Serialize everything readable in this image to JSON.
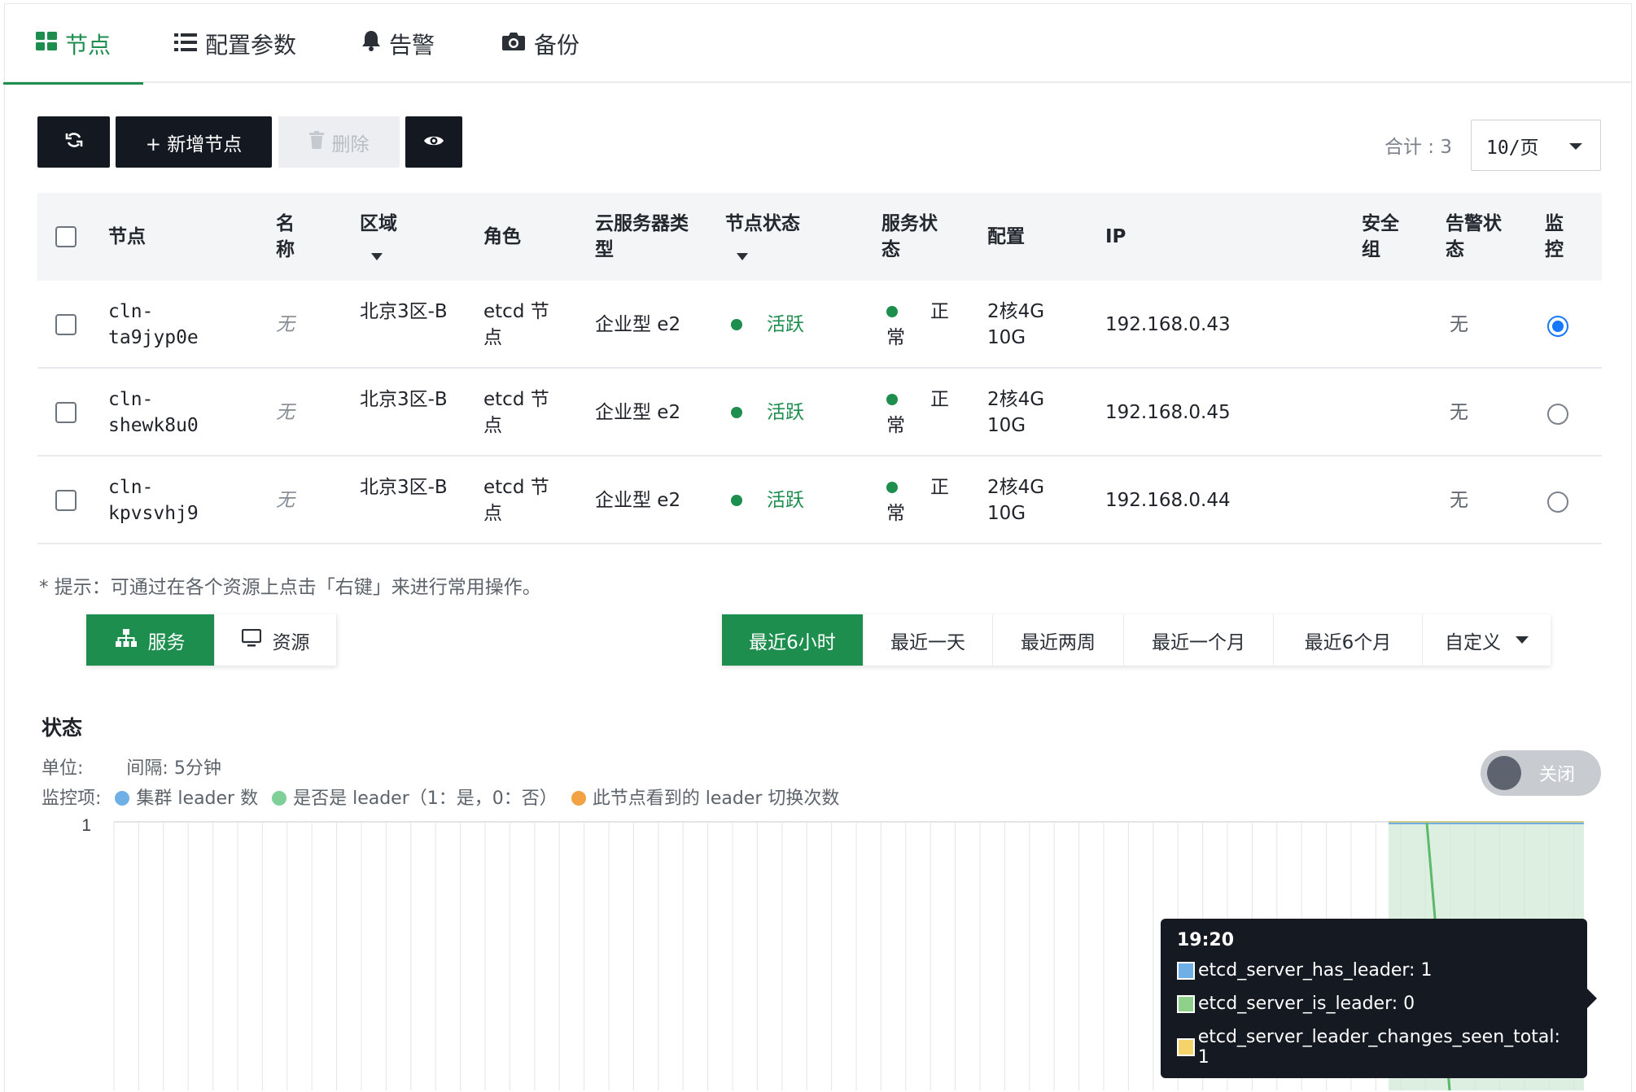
{
  "tabs": [
    {
      "label": "节点",
      "icon": "grid-icon"
    },
    {
      "label": "配置参数",
      "icon": "list-icon"
    },
    {
      "label": "告警",
      "icon": "bell-icon"
    },
    {
      "label": "备份",
      "icon": "camera-icon"
    }
  ],
  "toolbar": {
    "add_label": "+ 新增节点",
    "delete_label": "删除",
    "total_label": "合计 : 3",
    "page_size": "10/页"
  },
  "table": {
    "headers": {
      "node": "节点",
      "name": "名称",
      "region": "区域",
      "role": "角色",
      "cloud_type": "云服务器类型",
      "node_status": "节点状态",
      "service_status": "服务状态",
      "config": "配置",
      "ip": "IP",
      "security_group": "安全组",
      "alarm_status": "告警状态",
      "monitor": "监控"
    },
    "rows": [
      {
        "node": "cln-ta9jyp0e",
        "name": "无",
        "region": "北京3区-B",
        "role": "etcd 节点",
        "cloud_type": "企业型 e2",
        "node_status": "活跃",
        "service_status": "正常",
        "config_cpu_mem": "2核4G",
        "config_disk": "10G",
        "ip": "192.168.0.43",
        "alarm": "无",
        "monitored": true
      },
      {
        "node": "cln-shewk8u0",
        "name": "无",
        "region": "北京3区-B",
        "role": "etcd 节点",
        "cloud_type": "企业型 e2",
        "node_status": "活跃",
        "service_status": "正常",
        "config_cpu_mem": "2核4G",
        "config_disk": "10G",
        "ip": "192.168.0.45",
        "alarm": "无",
        "monitored": false
      },
      {
        "node": "cln-kpvsvhj9",
        "name": "无",
        "region": "北京3区-B",
        "role": "etcd 节点",
        "cloud_type": "企业型 e2",
        "node_status": "活跃",
        "service_status": "正常",
        "config_cpu_mem": "2核4G",
        "config_disk": "10G",
        "ip": "192.168.0.44",
        "alarm": "无",
        "monitored": false
      }
    ]
  },
  "hint": "* 提示：可通过在各个资源上点击「右键」来进行常用操作。",
  "views": {
    "service": "服务",
    "resource": "资源"
  },
  "ranges": [
    "最近6小时",
    "最近一天",
    "最近两周",
    "最近一个月",
    "最近6个月",
    "自定义"
  ],
  "section": {
    "title": "状态",
    "unit_label": "单位:",
    "interval": "间隔: 5分钟",
    "monitor_label": "监控项:",
    "legend": [
      {
        "label": "集群 leader 数",
        "color": "#6eb0e6"
      },
      {
        "label": "是否是 leader（1：是，0：否）",
        "color": "#7fcf99"
      },
      {
        "label": "此节点看到的 leader 切换次数",
        "color": "#f2a243"
      }
    ],
    "toggle_label": "关闭"
  },
  "chart_data": {
    "type": "line",
    "y_tick_labels": [
      "1"
    ],
    "series": [
      {
        "name": "etcd_server_has_leader",
        "color": "#6eb0e6",
        "points_visible": [
          1,
          1
        ]
      },
      {
        "name": "etcd_server_is_leader",
        "color": "#7fcf99",
        "points_visible": [
          1,
          0
        ]
      },
      {
        "name": "etcd_server_leader_changes_seen_total",
        "color": "#f5d36b",
        "points_visible": [
          1
        ]
      }
    ],
    "tooltip": {
      "time": "19:20",
      "items": [
        {
          "text": "etcd_server_has_leader: 1",
          "color": "#6eb0e6"
        },
        {
          "text": "etcd_server_is_leader: 0",
          "color": "#8fd18a"
        },
        {
          "text": "etcd_server_leader_changes_seen_total: 1",
          "color": "#f5d36b"
        }
      ]
    }
  },
  "colors": {
    "brand": "#1e8e4e",
    "primary": "#1677ff",
    "dark": "#141821"
  }
}
